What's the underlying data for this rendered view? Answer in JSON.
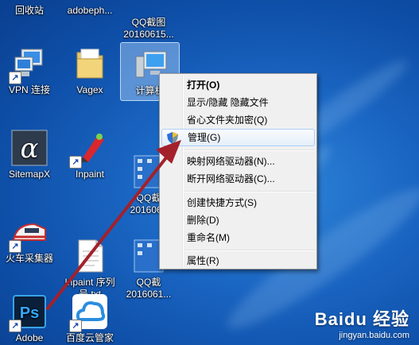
{
  "desktop": {
    "icons": [
      {
        "label": "回收站"
      },
      {
        "label": "adobeph..."
      },
      {
        "label": "QQ截图\n20160615..."
      },
      {
        "label": "VPN 连接"
      },
      {
        "label": "Vagex"
      },
      {
        "label": "计算机"
      },
      {
        "label": "SitemapX"
      },
      {
        "label": "Inpaint"
      },
      {
        "label": "QQ截\n2016061"
      },
      {
        "label": "火车采集器"
      },
      {
        "label": "Inpaint 序列\n号.txt"
      },
      {
        "label": "QQ截\n2016061..."
      },
      {
        "label": "Adobe"
      },
      {
        "label": "百度云管家"
      }
    ]
  },
  "context_menu": {
    "items": [
      {
        "label": "打开(O)",
        "bold": true
      },
      {
        "label": "显示/隐藏 隐藏文件"
      },
      {
        "label": "省心文件夹加密(Q)"
      },
      {
        "label": "管理(G)",
        "highlighted": true,
        "icon": "uac-shield-icon"
      },
      {
        "label": "映射网络驱动器(N)..."
      },
      {
        "label": "断开网络驱动器(C)..."
      },
      {
        "label": "创建快捷方式(S)"
      },
      {
        "label": "删除(D)"
      },
      {
        "label": "重命名(M)"
      },
      {
        "label": "属性(R)"
      }
    ]
  },
  "watermark": {
    "brand": "Baidu 经验",
    "url": "jingyan.baidu.com"
  },
  "colors": {
    "arrow": "#a3212a",
    "highlight_border": "#aecff7",
    "desktop": "#1b67c4"
  }
}
